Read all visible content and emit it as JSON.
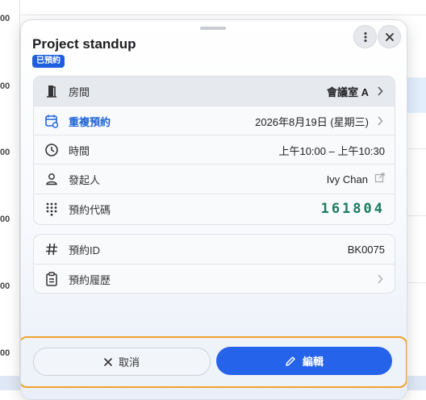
{
  "background": {
    "time_labels": [
      "00",
      "00",
      "00",
      "00",
      "00",
      "00"
    ]
  },
  "panel": {
    "title": "Project standup",
    "status_badge": "已預約"
  },
  "details": {
    "room": {
      "label": "房間",
      "value": "會議室 A"
    },
    "recurring": {
      "label": "重複預約",
      "value": "2026年8月19日 (星期三)"
    },
    "time": {
      "label": "時間",
      "value": "上午10:00 – 上午10:30"
    },
    "organizer": {
      "label": "發起人",
      "value": "Ivy Chan"
    },
    "code": {
      "label": "預約代碼",
      "value": "161804"
    }
  },
  "meta": {
    "booking_id": {
      "label": "預約ID",
      "value": "BK0075"
    },
    "history": {
      "label": "預約履歷"
    }
  },
  "footer": {
    "cancel_label": "取消",
    "edit_label": "編輯"
  },
  "colors": {
    "accent": "#2563eb",
    "badge": "#1e5fe0",
    "code": "#1b7a60",
    "focus_outline": "#f0a22d"
  }
}
